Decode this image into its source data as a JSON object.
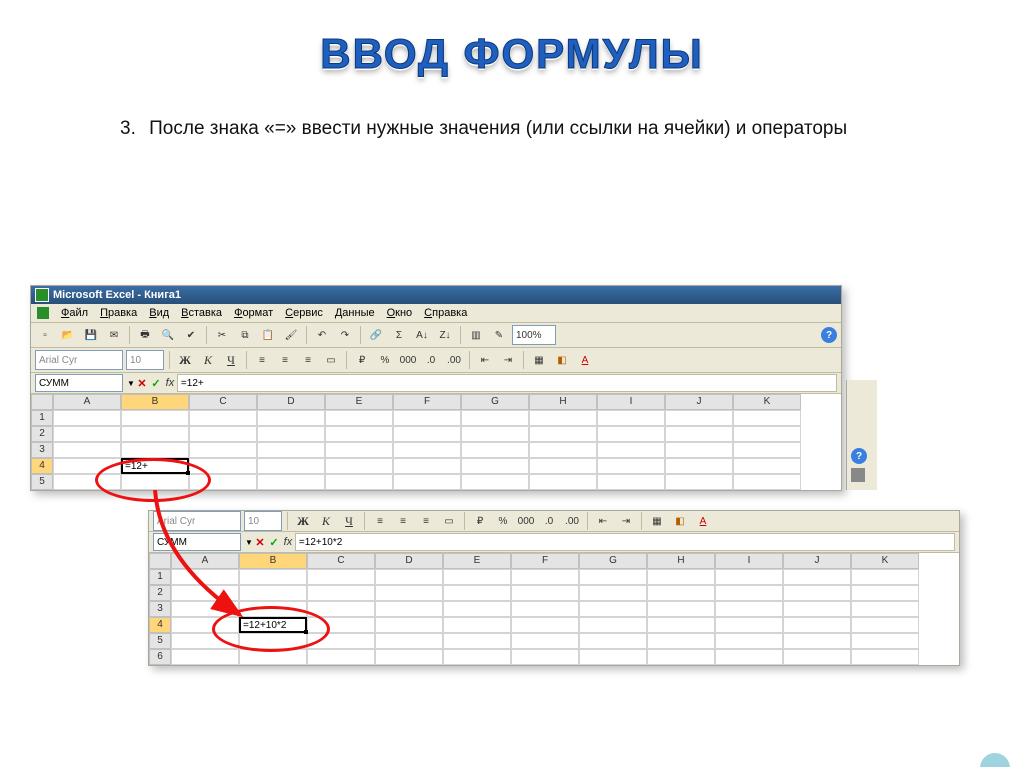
{
  "title": "ВВОД ФОРМУЛЫ",
  "bullet_num": "3.",
  "subtitle": "После знака «=» ввести нужные значения (или ссылки на ячейки) и операторы",
  "window_title": "Microsoft Excel - Книга1",
  "menus": [
    "Файл",
    "Правка",
    "Вид",
    "Вставка",
    "Формат",
    "Сервис",
    "Данные",
    "Окно",
    "Справка"
  ],
  "font_name": "Arial Cyr",
  "font_size": "10",
  "zoom": "100%",
  "bold": "Ж",
  "italic": "К",
  "underline": "Ч",
  "excel1": {
    "name_box": "СУММ",
    "formula": "=12+",
    "columns": [
      "A",
      "B",
      "C",
      "D",
      "E",
      "F",
      "G",
      "H",
      "I",
      "J",
      "K"
    ],
    "rows": [
      "1",
      "2",
      "3",
      "4",
      "5"
    ],
    "active_cell": {
      "row": "4",
      "col": "B",
      "text": "=12+"
    }
  },
  "excel2": {
    "name_box": "СУММ",
    "formula": "=12+10*2",
    "columns": [
      "A",
      "B",
      "C",
      "D",
      "E",
      "F",
      "G",
      "H",
      "I",
      "J",
      "K"
    ],
    "rows": [
      "1",
      "2",
      "3",
      "4",
      "5",
      "6"
    ],
    "active_cell": {
      "row": "4",
      "col": "B",
      "text": "=12+10*2"
    }
  }
}
